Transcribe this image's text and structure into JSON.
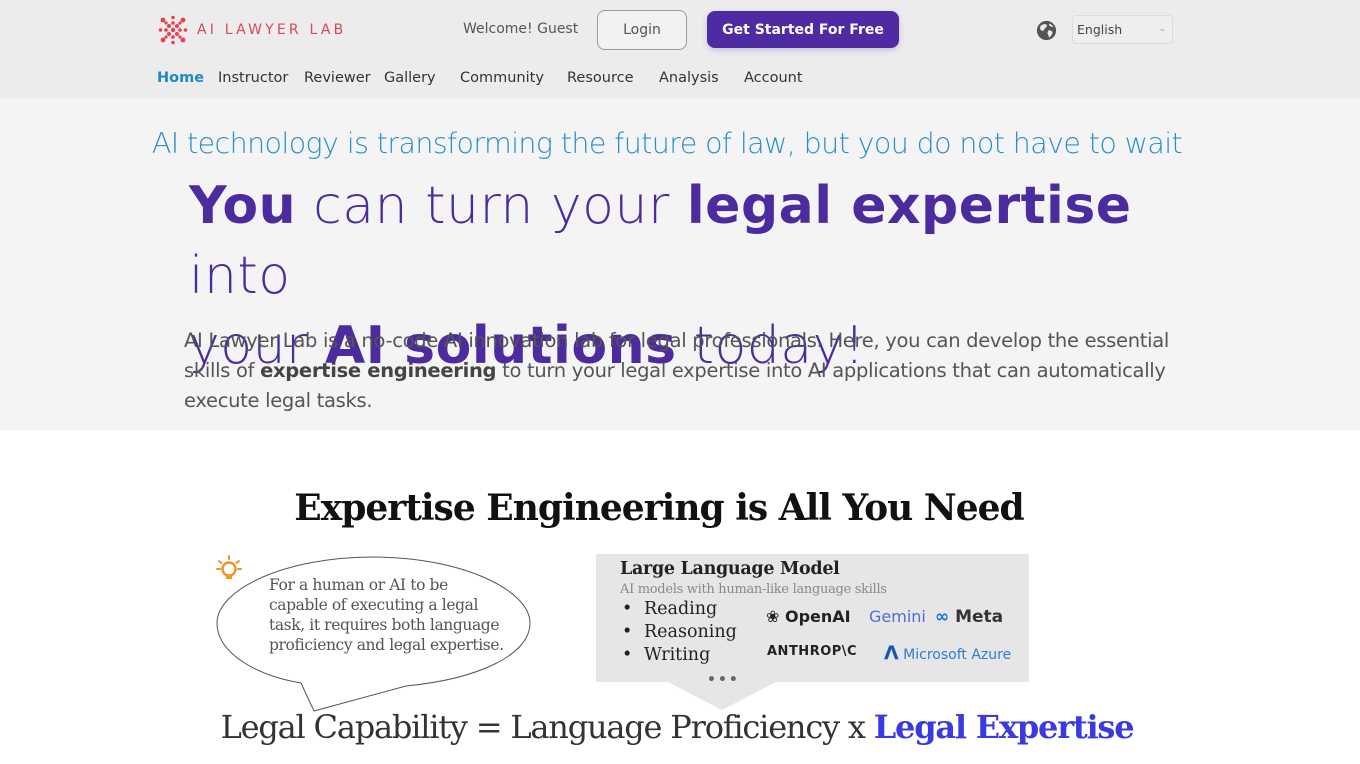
{
  "header": {
    "logo_text": "AI LAWYER LAB",
    "welcome_text": "Welcome! Guest",
    "login_label": "Login",
    "cta_label": "Get Started For Free",
    "language_selected": "English",
    "icons": {
      "logo": "network-logo-icon",
      "globe": "globe-icon",
      "dropdown": "chevron-down-icon"
    }
  },
  "nav": {
    "items": [
      {
        "label": "Home",
        "active": true
      },
      {
        "label": "Instructor",
        "active": false
      },
      {
        "label": "Reviewer",
        "active": false
      },
      {
        "label": "Gallery",
        "active": false
      },
      {
        "label": "Community",
        "active": false
      },
      {
        "label": "Resource",
        "active": false
      },
      {
        "label": "Analysis",
        "active": false
      },
      {
        "label": "Account",
        "active": false
      }
    ]
  },
  "hero": {
    "tagline": "AI technology is transforming the future of law, but you do not have to wait",
    "headline": {
      "part1_bold": "You",
      "part2": " can turn your ",
      "part3_bold": "legal expertise",
      "part4": " into",
      "part5": "your ",
      "part6_bold": "AI solutions",
      "part7": " today!"
    },
    "intro": {
      "part1": "AI Lawyer Lab is a no-code AI innovation lab for legal professionals. Here, you can develop the essential skills of ",
      "bold": "expertise engineering",
      "part2": " to turn your legal expertise into AI applications that can automatically execute legal tasks."
    }
  },
  "figure": {
    "title": "Expertise Engineering is All You Need",
    "bubble_text": "For a human or AI to be capable of executing a legal task, it requires both language proficiency and legal expertise.",
    "bubble_icon": "lightbulb-icon",
    "llm": {
      "title": "Large Language  Model",
      "subtitle": "AI models with human-like language skills",
      "skills": [
        "Reading",
        "Reasoning",
        "Writing"
      ],
      "ellipsis": "•••",
      "brands": {
        "openai": "OpenAI",
        "gemini": "Gemini",
        "meta": "Meta",
        "anthropic": "ANTHROP\\C",
        "azure": "Microsoft Azure"
      }
    },
    "formula": {
      "left": "Legal Capability = Language Proficiency x ",
      "highlight": "Legal  Expertise"
    }
  },
  "colors": {
    "brand_purple": "#4e2aa3",
    "headline_purple": "#4b2b9e",
    "tagline_blue": "#2b8fc9",
    "nav_active": "#1e88c8",
    "logo_red": "#d9475a",
    "formula_highlight": "#3a3ae0",
    "header_bg": "#ececec",
    "hero_bg": "#f4f4f4"
  }
}
